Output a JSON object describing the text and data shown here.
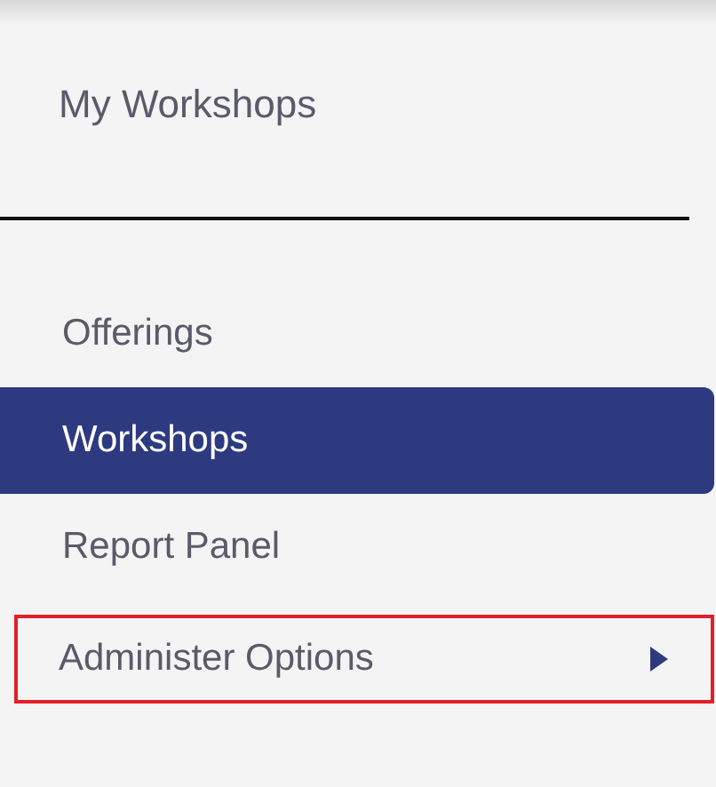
{
  "header": {
    "title": "My Workshops"
  },
  "menu": [
    {
      "label": "Offerings",
      "selected": false,
      "highlighted": false,
      "submenu": false
    },
    {
      "label": "Workshops",
      "selected": true,
      "highlighted": false,
      "submenu": false
    },
    {
      "label": "Report Panel",
      "selected": false,
      "highlighted": false,
      "submenu": false
    },
    {
      "label": "Administer Options",
      "selected": false,
      "highlighted": true,
      "submenu": true
    }
  ]
}
